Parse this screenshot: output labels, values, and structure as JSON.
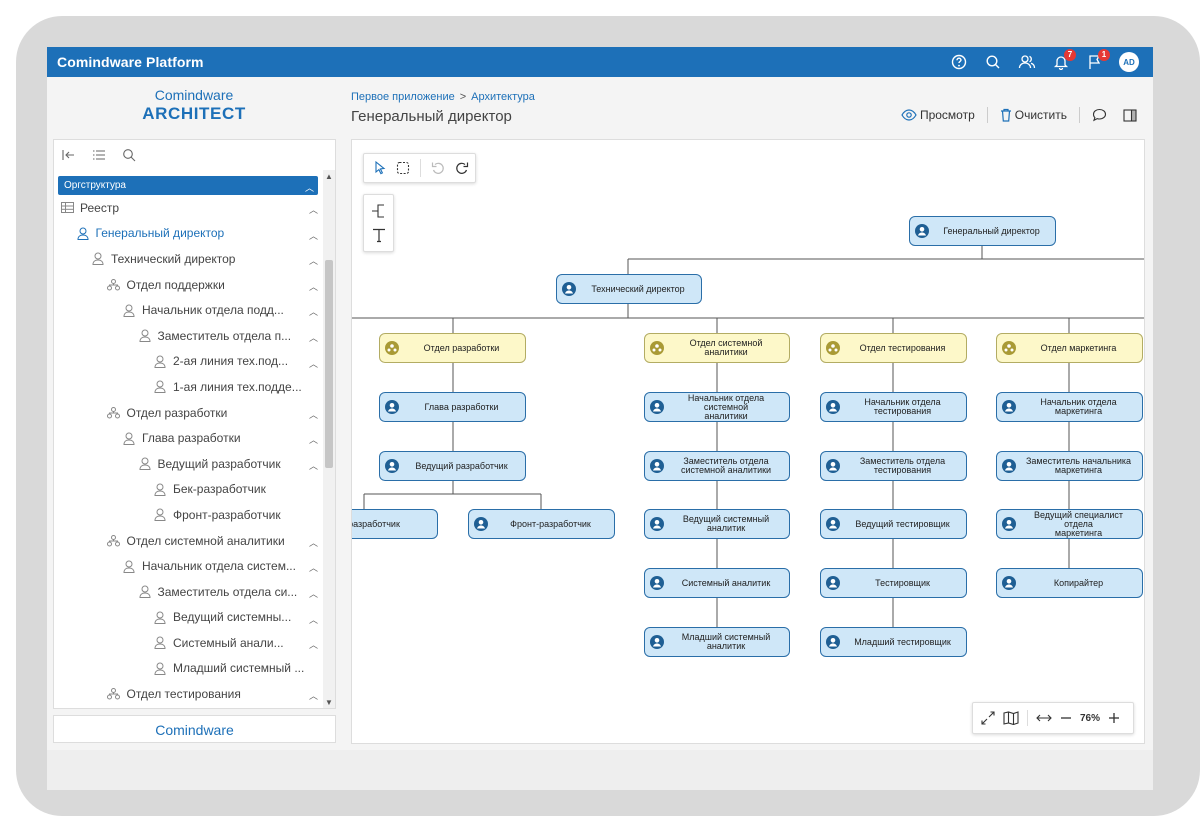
{
  "app": {
    "title": "Comindware Platform",
    "badges": {
      "notifications": "7",
      "messages": "1"
    },
    "avatar_initials": "AD",
    "accent": "#1d70b8"
  },
  "logo": {
    "brand": "Comindware",
    "product": "ARCHITECT",
    "footer": "Comindware"
  },
  "breadcrumb": {
    "items": [
      "Первое приложение",
      "Архитектура"
    ],
    "separator": ">"
  },
  "page_title": "Генеральный директор",
  "toolbar": {
    "preview_label": "Просмотр",
    "clear_label": "Очистить"
  },
  "tree": {
    "section_label": "Оргструктура",
    "items": [
      {
        "label": "Реестр",
        "icon": "table-icon"
      },
      {
        "label": "Генеральный директор",
        "icon": "person-icon"
      },
      {
        "label": "Технический директор",
        "icon": "person-icon"
      },
      {
        "label": "Отдел поддержки",
        "icon": "org-icon"
      },
      {
        "label": "Начальник отдела подд...",
        "icon": "person-icon"
      },
      {
        "label": "Заместитель отдела п...",
        "icon": "person-icon"
      },
      {
        "label": "2-ая линия тех.под...",
        "icon": "person-icon"
      },
      {
        "label": "1-ая линия тех.подде...",
        "icon": "person-icon"
      },
      {
        "label": "Отдел разработки",
        "icon": "org-icon"
      },
      {
        "label": "Глава разработки",
        "icon": "person-icon"
      },
      {
        "label": "Ведущий разработчик",
        "icon": "person-icon"
      },
      {
        "label": "Бек-разработчик",
        "icon": "person-icon"
      },
      {
        "label": "Фронт-разработчик",
        "icon": "person-icon"
      },
      {
        "label": "Отдел системной аналитики",
        "icon": "org-icon"
      },
      {
        "label": "Начальник отдела систем...",
        "icon": "person-icon"
      },
      {
        "label": "Заместитель отдела си...",
        "icon": "person-icon"
      },
      {
        "label": "Ведущий системны...",
        "icon": "person-icon"
      },
      {
        "label": "Системный анали...",
        "icon": "person-icon"
      },
      {
        "label": "Младший системный ...",
        "icon": "person-icon"
      },
      {
        "label": "Отдел тестирования",
        "icon": "org-icon"
      }
    ]
  },
  "chart": {
    "nodes": [
      {
        "label": "Генеральный директор",
        "type": "person"
      },
      {
        "label": "Технический директор",
        "type": "person"
      },
      {
        "label": "Отдел разработки",
        "type": "dept"
      },
      {
        "label": "Глава разработки",
        "type": "person"
      },
      {
        "label": "Ведущий разработчик",
        "type": "person"
      },
      {
        "label": "разработчик",
        "type": "person"
      },
      {
        "label": "Фронт-разработчик",
        "type": "person"
      },
      {
        "label": "Отдел системной аналитики",
        "type": "dept"
      },
      {
        "label": "Начальник отдела системной\nаналитики",
        "type": "person"
      },
      {
        "label": "Заместитель отдела\nсистемной аналитики",
        "type": "person"
      },
      {
        "label": "Ведущий системный аналитик",
        "type": "person"
      },
      {
        "label": "Системный аналитик",
        "type": "person"
      },
      {
        "label": "Младший системный\nаналитик",
        "type": "person"
      },
      {
        "label": "Отдел тестирования",
        "type": "dept"
      },
      {
        "label": "Начальник отдела\nтестирования",
        "type": "person"
      },
      {
        "label": "Заместитель отдела\nтестирования",
        "type": "person"
      },
      {
        "label": "Ведущий тестировщик",
        "type": "person"
      },
      {
        "label": "Тестировщик",
        "type": "person"
      },
      {
        "label": "Младший тестировщик",
        "type": "person"
      },
      {
        "label": "Отдел маркетинга",
        "type": "dept"
      },
      {
        "label": "Начальник отдела маркетинга",
        "type": "person"
      },
      {
        "label": "Заместитель начальника\nмаркетинга",
        "type": "person"
      },
      {
        "label": "Ведущий специалист отдела\nмаркетинга",
        "type": "person"
      },
      {
        "label": "Копирайтер",
        "type": "person"
      }
    ]
  },
  "zoom": {
    "value": "76%"
  }
}
